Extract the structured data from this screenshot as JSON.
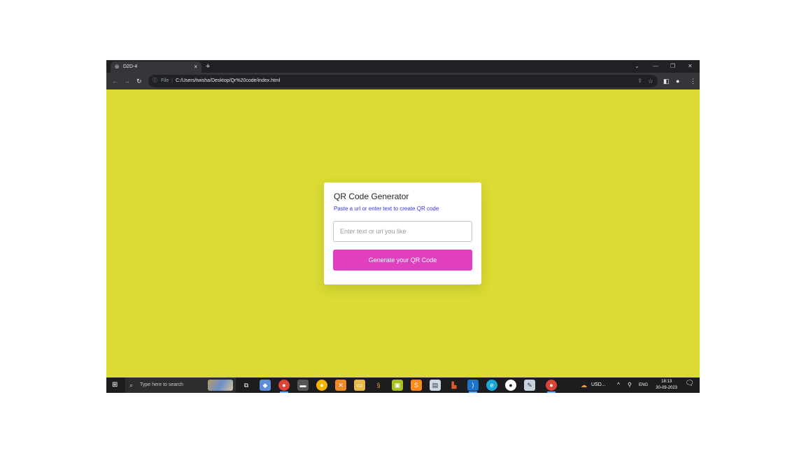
{
  "browser": {
    "tab_title": "D2D-4",
    "tab_close": "×",
    "new_tab": "+",
    "omnibox_file_label": "File",
    "omnibox_separator": "|",
    "url": "C:/Users/twisha/Desktop/Qr%20code/index.html"
  },
  "card": {
    "title": "QR Code Generator",
    "subtitle": "Paste a url or enter text to create QR code",
    "input_placeholder": "Enter text or url you like",
    "input_value": "",
    "button_label": "Generate your QR Code"
  },
  "taskbar": {
    "search_placeholder": "Type here to search",
    "weather_text": "USD...",
    "language": "ENG",
    "time": "18:13",
    "date": "30-09-2023"
  },
  "colors": {
    "page_background": "#dbdb34",
    "subtitle": "#3b34e6",
    "button": "#e03fbd"
  }
}
